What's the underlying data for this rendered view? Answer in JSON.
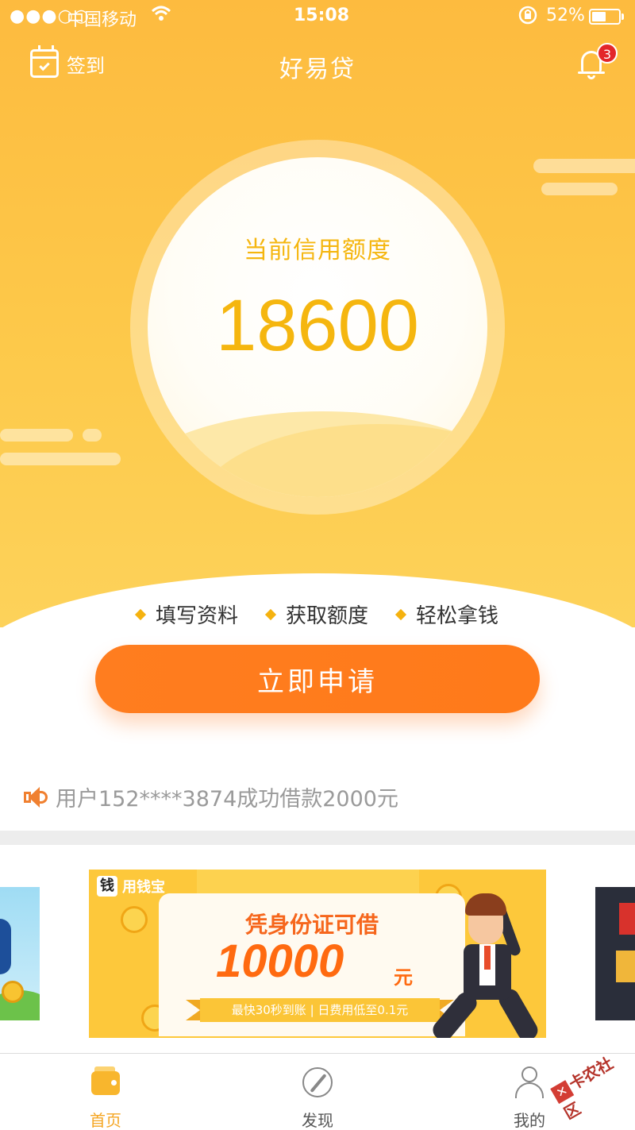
{
  "status_bar": {
    "signal": "●●●○○",
    "carrier": "中国移动",
    "time": "15:08",
    "battery": "52%",
    "battery_level": 0.52
  },
  "nav": {
    "checkin_label": "签到",
    "title": "好易贷",
    "notification_count": "3"
  },
  "credit": {
    "label": "当前信用额度",
    "amount": "18600"
  },
  "steps": [
    "填写资料",
    "获取额度",
    "轻松拿钱"
  ],
  "apply_button": "立即申请",
  "notice": "用户152****3874成功借款2000元",
  "banner": {
    "brand_logo": "钱",
    "brand_name": "用钱宝",
    "headline": "凭身份证可借",
    "amount": "10000",
    "unit": "元",
    "ribbon": "最快30秒到账 | 日费用低至0.1元"
  },
  "tabbar": {
    "tabs": [
      {
        "label": "首页",
        "icon": "wallet-icon",
        "active": true
      },
      {
        "label": "发现",
        "icon": "compass-icon",
        "active": false
      },
      {
        "label": "我的",
        "icon": "person-icon",
        "active": false
      }
    ]
  },
  "watermark": "卡农社区",
  "colors": {
    "brand_yellow": "#fdc23f",
    "accent_orange": "#ff7d1f",
    "credit_text": "#f5b60f",
    "badge_red": "#e3262a"
  }
}
